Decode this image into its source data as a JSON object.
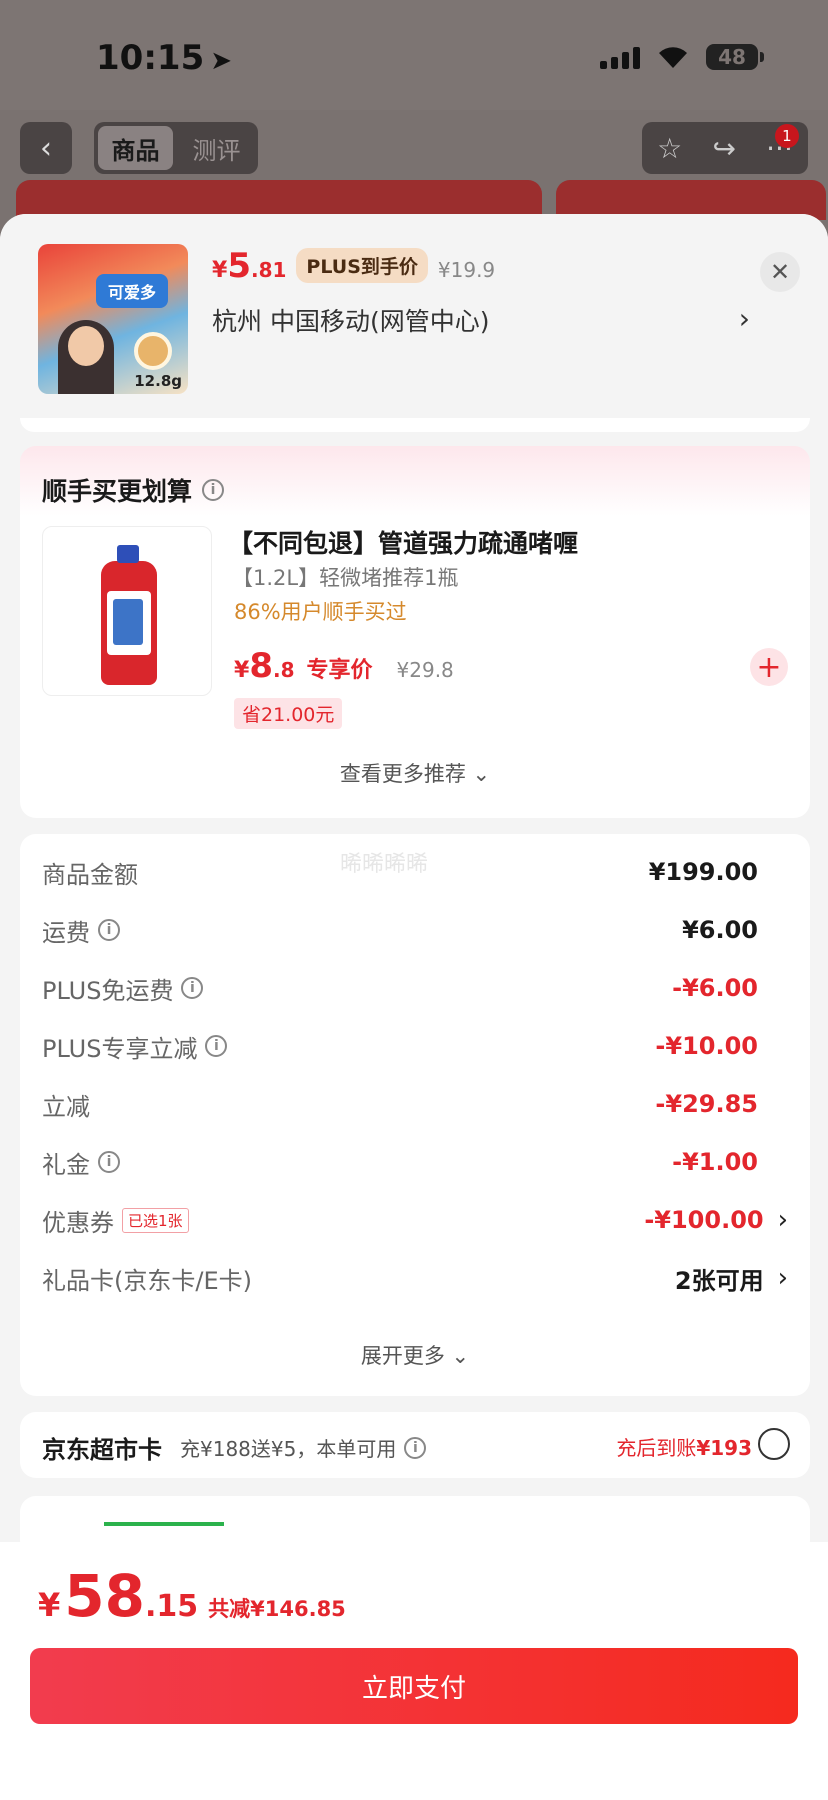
{
  "status_bar": {
    "time": "10:15",
    "battery": "48"
  },
  "nav": {
    "tabs": [
      {
        "label": "商品"
      },
      {
        "label": "测评"
      }
    ],
    "notification_count": "1"
  },
  "product": {
    "price_yen": "¥",
    "price_int": "5",
    "price_dec": ".81",
    "plus_tag": "PLUS到手价",
    "original_price": "¥19.9",
    "address": "杭州  中国移动(网管中心)",
    "thumb_weight": "12.8g"
  },
  "upsell": {
    "title": "顺手买更划算",
    "item_name": "【不同包退】管道强力疏通啫喱",
    "item_spec": "【1.2L】轻微堵推荐1瓶",
    "buy_rate": "86%用户顺手买过",
    "price_yen": "¥",
    "price_int": "8",
    "price_dec": ".8",
    "price_tag": "专享价",
    "original_price": "¥29.8",
    "save_text": "省21.00元",
    "more_label": "查看更多推荐"
  },
  "breakdown": {
    "watermark": "晞晞晞晞",
    "rows": [
      {
        "label": "商品金额",
        "value": "¥199.00"
      },
      {
        "label": "运费",
        "value": "¥6.00"
      },
      {
        "label": "PLUS免运费",
        "value": "-¥6.00"
      },
      {
        "label": "PLUS专享立减",
        "value": "-¥10.00"
      },
      {
        "label": "立减",
        "value": "-¥29.85"
      },
      {
        "label": "礼金",
        "value": "-¥1.00"
      },
      {
        "label": "优惠券",
        "chosen": "已选1张",
        "value": "-¥100.00"
      },
      {
        "label": "礼品卡(京东卡/E卡)",
        "value": "2张可用"
      }
    ],
    "expand_label": "展开更多"
  },
  "supermarket_card": {
    "title": "京东超市卡",
    "desc": "充¥188送¥5，本单可用",
    "right_prefix": "充后到账",
    "right_amount": "¥193"
  },
  "footer": {
    "total_yen": "¥",
    "total_int": "58",
    "total_dec": ".15",
    "total_saved": "共减¥146.85",
    "pay_label": "立即支付"
  },
  "colors": {
    "accent_red": "#e3262d",
    "plus_gold": "#f5dcc4",
    "rate_orange": "#d5892c"
  }
}
